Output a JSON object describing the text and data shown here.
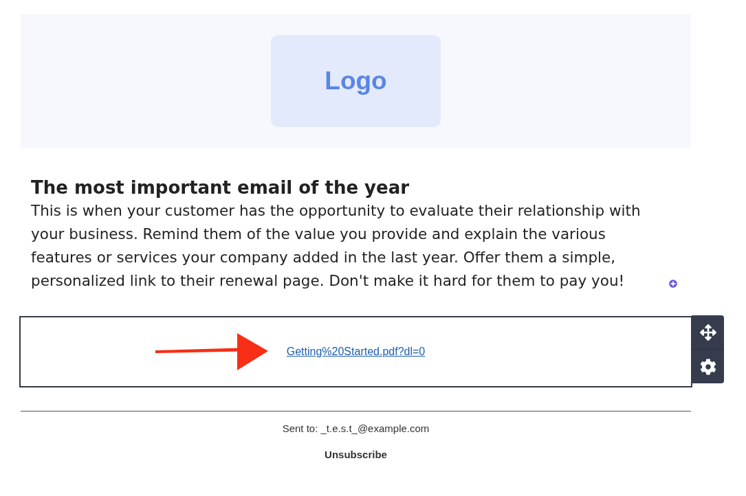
{
  "header": {
    "logo": "Logo"
  },
  "content": {
    "heading": "The most important email of the year",
    "body": "This is when your customer has the opportunity to evaluate their relationship with your business. Remind them of the value you provide and explain the various features or services your company added in the last year. Offer them a simple, personalized link to their renewal page. Don't make it hard for them to pay you!"
  },
  "link_block": {
    "link": "Getting%20Started.pdf?dl=0",
    "toolbar": [
      {
        "kind": "move"
      },
      {
        "kind": "settings"
      }
    ]
  },
  "footer": {
    "sent_to": "Sent to: _t.e.s.t_@example.com",
    "unsubscribe": "Unsubscribe"
  }
}
